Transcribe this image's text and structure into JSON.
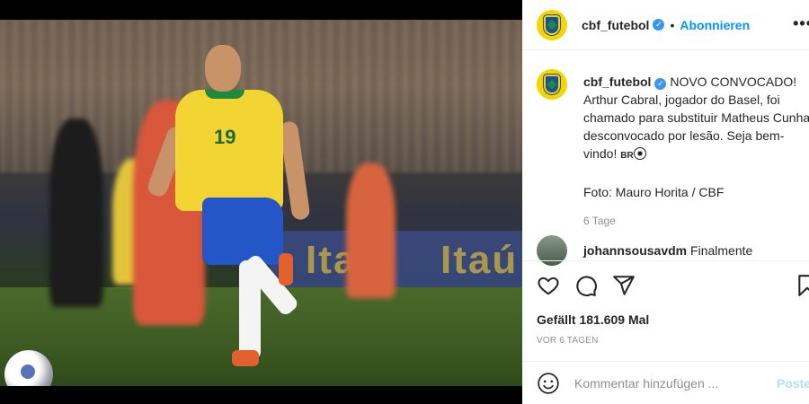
{
  "post": {
    "author": "cbf_futebol",
    "verified_mark": "✓",
    "follow_label": "Abonnieren",
    "more_label": "•••",
    "caption_lines": [
      "NOVO CONVOCADO!",
      "Arthur Cabral, jogador do Basel, foi",
      "chamado para substituir Matheus Cunha,",
      "desconvocado por lesão. Seja bem-",
      "vindo!"
    ],
    "caption_flag": "BR",
    "caption_credit": "Foto: Mauro Horita / CBF",
    "caption_age": "6 Tage",
    "likes": "Gefällt 181.609 Mal",
    "date": "VOR 6 TAGEN"
  },
  "photo": {
    "ad_text": "Itaú",
    "jersey_number": "19"
  },
  "comments": [
    {
      "user": "johannsousavdm",
      "text": "Finalmente"
    }
  ],
  "add_comment": {
    "placeholder": "Kommentar hinzufügen ...",
    "post_label": "Posten"
  },
  "icons": {
    "like": "heart-icon",
    "comment": "comment-icon",
    "share": "share-icon",
    "save": "bookmark-icon",
    "emoji": "smiley-icon"
  },
  "colors": {
    "accent": "#0095f6",
    "verified": "#3897f0",
    "cbf_yellow": "#f5d400",
    "cbf_blue": "#1a4fa0"
  }
}
